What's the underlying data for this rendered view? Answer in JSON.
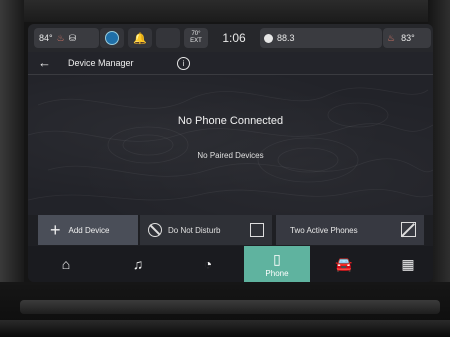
{
  "status_bar": {
    "left_temp": "84°",
    "seat_heat_icon": "seat-heat-icon",
    "alexa_icon": "alexa-icon",
    "bell_icon": "bell-icon",
    "ext_temp": "70°",
    "ext_label": "EXT",
    "time": "1:06",
    "radio_station": "88.3",
    "right_temp": "83°",
    "seat_icon": "seat-icon"
  },
  "title_bar": {
    "back_icon": "back-arrow-icon",
    "title": "Device Manager",
    "info_icon": "info-icon"
  },
  "main": {
    "heading": "No Phone Connected",
    "subtext": "No Paired Devices"
  },
  "actions": {
    "add_device": "Add Device",
    "do_not_disturb": "Do Not Disturb",
    "two_active_phones": "Two Active Phones"
  },
  "nav": {
    "items": [
      {
        "icon": "home-icon",
        "label": ""
      },
      {
        "icon": "music-icon",
        "label": ""
      },
      {
        "icon": "apps-dial-icon",
        "label": ""
      },
      {
        "icon": "phone-icon",
        "label": "Phone"
      },
      {
        "icon": "car-icon",
        "label": ""
      },
      {
        "icon": "grid-icon",
        "label": ""
      }
    ]
  },
  "colors": {
    "accent": "#5fb39f",
    "background": "#1e1f23"
  }
}
